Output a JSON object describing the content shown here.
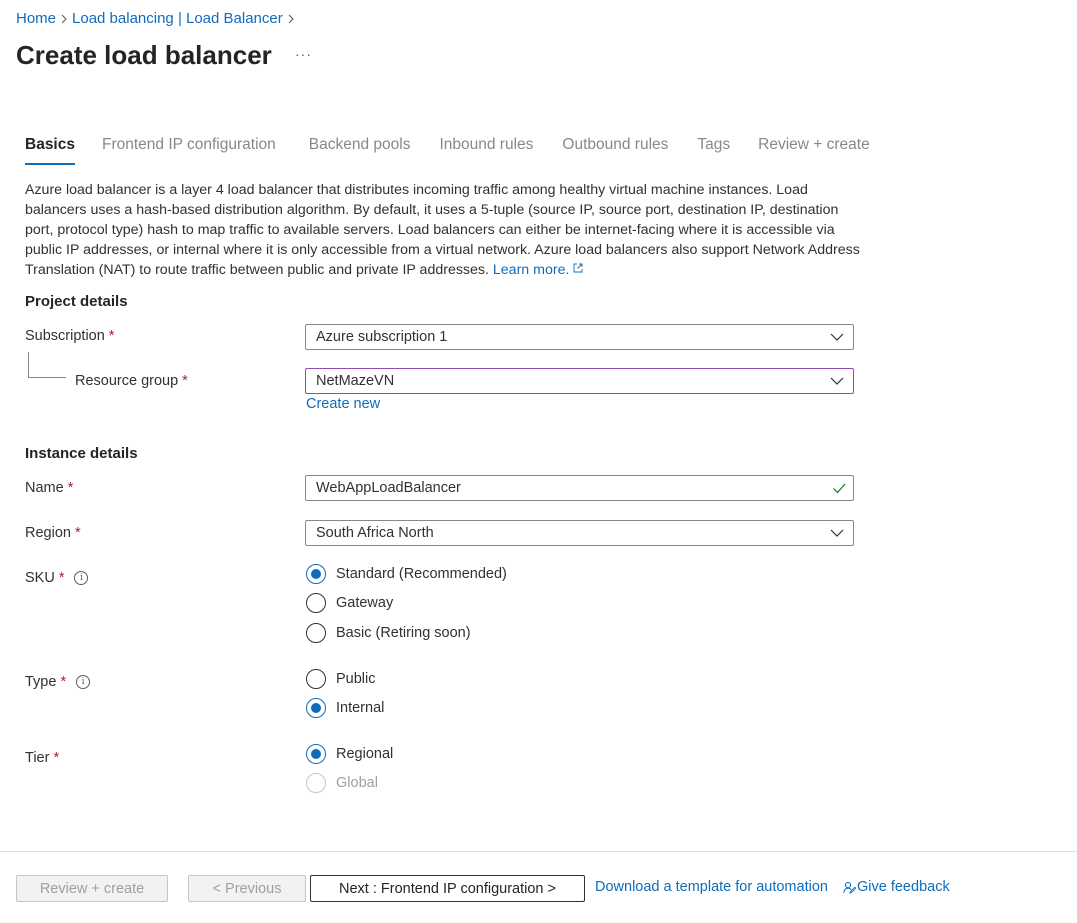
{
  "breadcrumb": {
    "home": "Home",
    "parent": "Load balancing | Load Balancer"
  },
  "page_title": "Create load balancer",
  "more_label": "···",
  "tabs": [
    "Basics",
    "Frontend IP configuration",
    "Backend pools",
    "Inbound rules",
    "Outbound rules",
    "Tags",
    "Review + create"
  ],
  "description": {
    "text": "Azure load balancer is a layer 4 load balancer that distributes incoming traffic among healthy virtual machine instances. Load balancers uses a hash-based distribution algorithm. By default, it uses a 5-tuple (source IP, source port, destination IP, destination port, protocol type) hash to map traffic to available servers. Load balancers can either be internet-facing where it is accessible via public IP addresses, or internal where it is only accessible from a virtual network. Azure load balancers also support Network Address Translation (NAT) to route traffic between public and private IP addresses.",
    "learn_more": "Learn more."
  },
  "project_details": {
    "heading": "Project details",
    "subscription_label": "Subscription",
    "subscription_value": "Azure subscription 1",
    "resource_group_label": "Resource group",
    "resource_group_value": "NetMazeVN",
    "create_new": "Create new"
  },
  "instance_details": {
    "heading": "Instance details",
    "name_label": "Name",
    "name_value": "WebAppLoadBalancer",
    "region_label": "Region",
    "region_value": "South Africa North",
    "sku_label": "SKU",
    "sku_options": [
      "Standard (Recommended)",
      "Gateway",
      "Basic (Retiring soon)"
    ],
    "sku_selected": "Standard (Recommended)",
    "type_label": "Type",
    "type_options": [
      "Public",
      "Internal"
    ],
    "type_selected": "Internal",
    "tier_label": "Tier",
    "tier_options": [
      "Regional",
      "Global"
    ],
    "tier_selected": "Regional"
  },
  "required_marker": "*",
  "info_glyph": "i",
  "footer": {
    "review_create": "Review + create",
    "previous": "< Previous",
    "next": "Next : Frontend IP configuration >",
    "download_template": "Download a template for automation",
    "give_feedback": "Give feedback"
  },
  "colors": {
    "accent": "#0f6cbd",
    "required": "#a4262c",
    "focus_border": "#8e4bb9",
    "valid": "#107c10"
  },
  "icons": [
    "chevron-right-icon",
    "external-link-icon",
    "chevron-down-icon",
    "checkmark-icon",
    "info-icon",
    "feedback-icon"
  ]
}
